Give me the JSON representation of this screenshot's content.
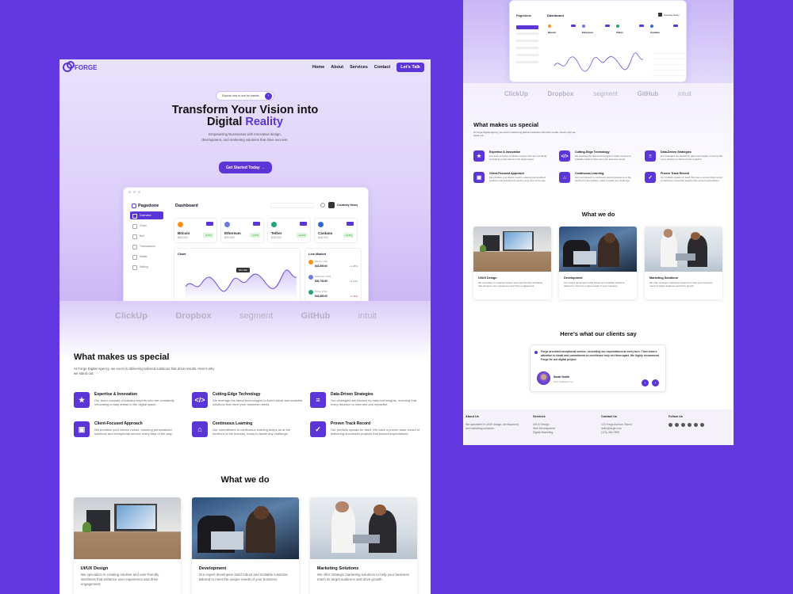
{
  "left": {
    "brand": "FORGE",
    "nav": [
      "Home",
      "About",
      "Services",
      "Contact"
    ],
    "nav_cta": "Let's Talk",
    "announce": "Explore how to use for brands",
    "hero_line1": "Transform Your Vision into",
    "hero_line2_a": "Digital ",
    "hero_line2_b": "Reality",
    "hero_sub": "Empowering Businesses with Innovative design, development, and marketing solutions that drive success.",
    "hero_cta": "Get Started Today",
    "dash": {
      "brand": "Pagedone",
      "title": "Dashboard",
      "user": "Courtney Henry",
      "menu": [
        "Overview",
        "Chart",
        "Bell",
        "Transactions",
        "Wallet",
        "Setting"
      ],
      "tickers": [
        {
          "name": "Bitcoin",
          "sym": "BTC",
          "value": "$89,000",
          "color": "#f7931a",
          "chg": "+5.6%"
        },
        {
          "name": "Ethereum",
          "sym": "ETH",
          "value": "$25,000",
          "color": "#6c7ae0",
          "chg": "+4.6%"
        },
        {
          "name": "Tether",
          "sym": "USDT",
          "value": "$28,000",
          "color": "#26a17b",
          "chg": "+3.2%"
        },
        {
          "name": "Cardano",
          "sym": "ADA",
          "value": "$45,000",
          "color": "#3468d1",
          "chg": "+2.8%"
        }
      ],
      "chart_title": "Chart",
      "chart_tag": "$42,300",
      "market_title": "Live Market",
      "market": [
        {
          "name": "Bitcoin USD",
          "val": "$43,890.00",
          "chg": "+1.26%",
          "color": "#f7931a"
        },
        {
          "name": "Ethereum USD",
          "val": "$30,740.50",
          "chg": "+2.10%",
          "color": "#6c7ae0"
        },
        {
          "name": "Tether USD",
          "val": "$43,890.00",
          "chg": "-0.76%",
          "color": "#26a17b"
        }
      ]
    },
    "clients": [
      "ClickUp",
      "Dropbox",
      "segment",
      "GitHub",
      "intuit"
    ],
    "special_title": "What makes us special",
    "special_sub": "At Forge Digital Agency, we excel in delivering tailored solutions that drive results. Here's why we stand out:",
    "features": [
      {
        "t": "Expertise & Innovation",
        "d": "Our team consists of industry experts who are constantly innovating to stay ahead in the digital space.",
        "ic": "★"
      },
      {
        "t": "Cutting-Edge Technology",
        "d": "We leverage the latest technologies to build robust and scalable solutions that meet your business needs.",
        "ic": "</>"
      },
      {
        "t": "Data-Driven Strategies",
        "d": "Our strategies are backed by data and insights, ensuring that every decision is informed and impactful.",
        "ic": "≡"
      },
      {
        "t": "Client-Focused Approach",
        "d": "We prioritize your clients' needs, ensuring personalized solutions and exceptional service every step of the way.",
        "ic": "▣"
      },
      {
        "t": "Continuous Learning",
        "d": "Our commitment to continuous learning keeps us at the forefront of the industry, ready to tackle any challenge.",
        "ic": "⌂"
      },
      {
        "t": "Proven Track Record",
        "d": "Our portfolio speaks for itself. We have a proven track record of delivering successful projects that exceed expectations.",
        "ic": "✓"
      }
    ],
    "what_title": "What we do",
    "services": [
      {
        "t": "UI/UX Design",
        "d": "We specialize in creating intuitive and user-friendly interfaces that enhance user experience and drive engagement."
      },
      {
        "t": "Development",
        "d": "Our expert developers build robust and scalable solutions tailored to meet the unique needs of your business."
      },
      {
        "t": "Marketing Solutions",
        "d": "We offer strategic marketing solutions to help your business reach its target audience and drive growth."
      }
    ]
  },
  "right": {
    "testimonial_title": "Here's what our clients say",
    "quote": "Forge provided exceptional service, exceeding our expectations at every turn. Their team's attention to detail and commitment to excellence truly set them apart. We highly recommend Forge for our digital project.",
    "author": "Sarah Smith",
    "author_role": "Tech Solutions Inc.",
    "footer": {
      "about_h": "About Us",
      "about": "We specialize in UI/UX design, development, and marketing solutions.",
      "services_h": "Services",
      "services": [
        "UI/UX Design",
        "Web Development",
        "Digital Marketing"
      ],
      "contact_h": "Contact Us",
      "contact": [
        "123 Forge Avenue, Brand",
        "hello@forge.com",
        "(123) 456-7890"
      ],
      "follow_h": "Follow Us"
    }
  },
  "colors": {
    "bg": "#6438e0",
    "accent": "#5b35d6"
  }
}
